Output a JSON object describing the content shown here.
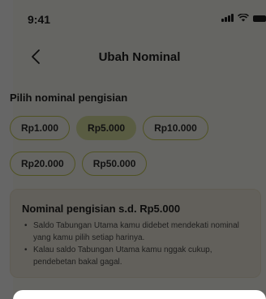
{
  "status_bar": {
    "time": "9:41"
  },
  "header": {
    "title": "Ubah Nominal"
  },
  "section": {
    "label": "Pilih nominal pengisian"
  },
  "chips": [
    {
      "label": "Rp1.000",
      "selected": false
    },
    {
      "label": "Rp5.000",
      "selected": true
    },
    {
      "label": "Rp10.000",
      "selected": false
    },
    {
      "label": "Rp20.000",
      "selected": false
    },
    {
      "label": "Rp50.000",
      "selected": false
    }
  ],
  "info": {
    "title": "Nominal pengisian s.d. Rp5.000",
    "bullets": [
      "Saldo Tabungan Utama kamu didebet mendekati nominal yang kamu pilih setiap harinya.",
      "Kalau saldo Tabungan Utama kamu nggak cukup, pendebetan bakal gagal."
    ]
  },
  "colors": {
    "chip_border": "#c7cc55",
    "chip_selected_bg": "#dfe7a6",
    "screen_bg": "#fdfdf6",
    "info_bg": "#f6f1e3"
  }
}
